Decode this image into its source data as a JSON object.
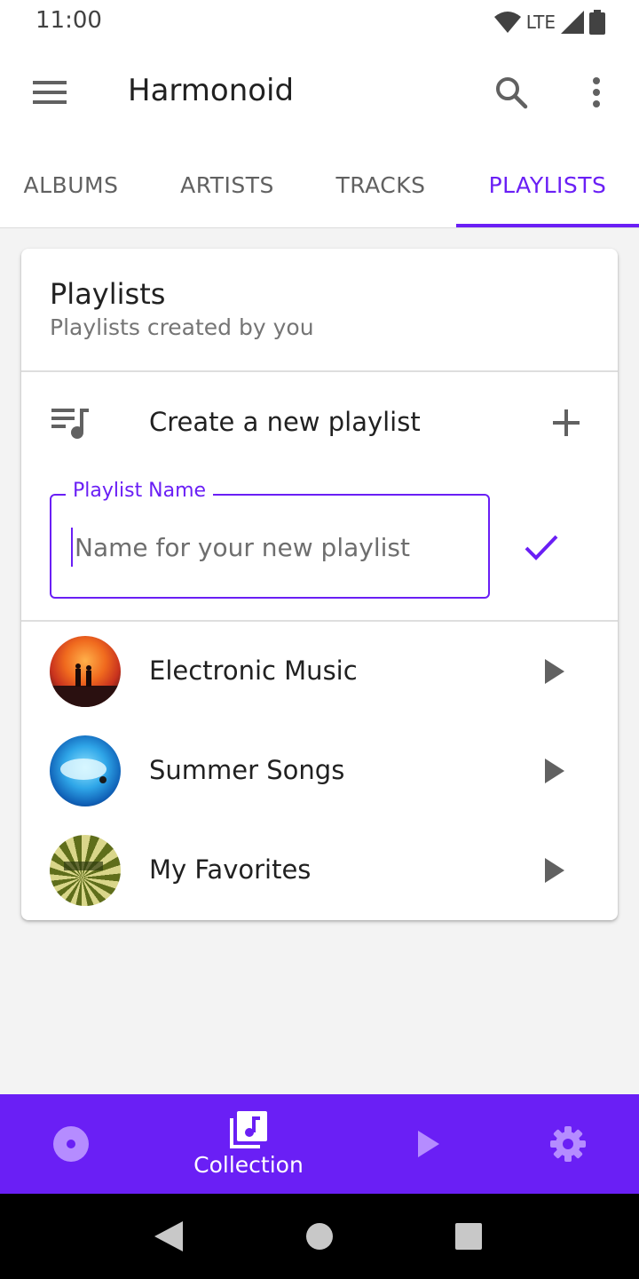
{
  "status_bar": {
    "time": "11:00",
    "network": "LTE",
    "icons": [
      "wifi-icon",
      "cell-signal-icon",
      "battery-icon"
    ]
  },
  "app_bar": {
    "title": "Harmonoid",
    "icons": [
      "menu-icon",
      "search-icon",
      "more-vert-icon"
    ]
  },
  "tabs": [
    {
      "label": "ALBUMS",
      "active": false
    },
    {
      "label": "ARTISTS",
      "active": false
    },
    {
      "label": "TRACKS",
      "active": false
    },
    {
      "label": "PLAYLISTS",
      "active": true
    }
  ],
  "card": {
    "title": "Playlists",
    "subtitle": "Playlists created by you",
    "create_label": "Create a new playlist",
    "name_field": {
      "label": "Playlist Name",
      "placeholder": "Name for your new playlist",
      "value": ""
    },
    "playlists": [
      {
        "name": "Electronic Music",
        "cover": "sunset-couple-art"
      },
      {
        "name": "Summer Songs",
        "cover": "blue-cloud-art"
      },
      {
        "name": "My Favorites",
        "cover": "green-sunburst-art"
      }
    ]
  },
  "bottom_nav": {
    "items": [
      {
        "label": "",
        "icon": "album-disc-icon",
        "active": false
      },
      {
        "label": "Collection",
        "icon": "library-music-icon",
        "active": true
      },
      {
        "label": "",
        "icon": "play-icon",
        "active": false
      },
      {
        "label": "",
        "icon": "settings-gear-icon",
        "active": false
      }
    ]
  },
  "colors": {
    "accent": "#6a1ff5",
    "background": "#f3f3f3",
    "nav_inactive_icon": "#b58cff"
  }
}
